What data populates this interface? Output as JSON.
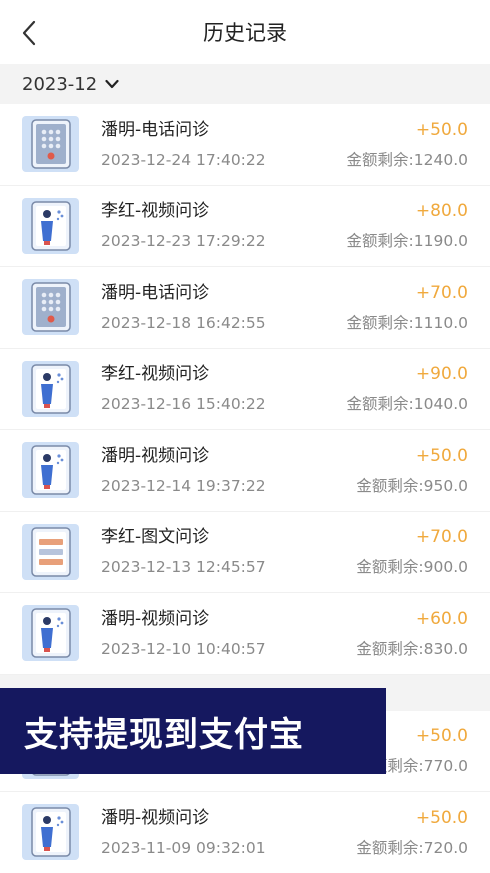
{
  "header": {
    "title": "历史记录"
  },
  "section_dec": {
    "label": "2023-12"
  },
  "section_nov": {
    "label": ""
  },
  "records": [
    {
      "name": "潘明-电话问诊",
      "time": "2023-12-24 17:40:22",
      "amount": "+50.0",
      "balance": "金额剩余:1240.0",
      "type": "phone"
    },
    {
      "name": "李红-视频问诊",
      "time": "2023-12-23 17:29:22",
      "amount": "+80.0",
      "balance": "金额剩余:1190.0",
      "type": "video"
    },
    {
      "name": "潘明-电话问诊",
      "time": "2023-12-18 16:42:55",
      "amount": "+70.0",
      "balance": "金额剩余:1110.0",
      "type": "phone"
    },
    {
      "name": "李红-视频问诊",
      "time": "2023-12-16 15:40:22",
      "amount": "+90.0",
      "balance": "金额剩余:1040.0",
      "type": "video"
    },
    {
      "name": "潘明-视频问诊",
      "time": "2023-12-14 19:37:22",
      "amount": "+50.0",
      "balance": "金额剩余:950.0",
      "type": "video"
    },
    {
      "name": "李红-图文问诊",
      "time": "2023-12-13 12:45:57",
      "amount": "+70.0",
      "balance": "金额剩余:900.0",
      "type": "text"
    },
    {
      "name": "潘明-视频问诊",
      "time": "2023-12-10 10:40:57",
      "amount": "+60.0",
      "balance": "金额剩余:830.0",
      "type": "video"
    },
    {
      "name": "",
      "time": "",
      "amount": "+50.0",
      "balance": "金额剩余:770.0",
      "type": "video"
    },
    {
      "name": "潘明-视频问诊",
      "time": "2023-11-09 09:32:01",
      "amount": "+50.0",
      "balance": "金额剩余:720.0",
      "type": "video"
    }
  ],
  "banner": {
    "text": "支持提现到支付宝"
  },
  "colors": {
    "amount": "#f0a93d",
    "banner_bg": "#15185f",
    "thumb_bg": "#cfe0f6"
  }
}
